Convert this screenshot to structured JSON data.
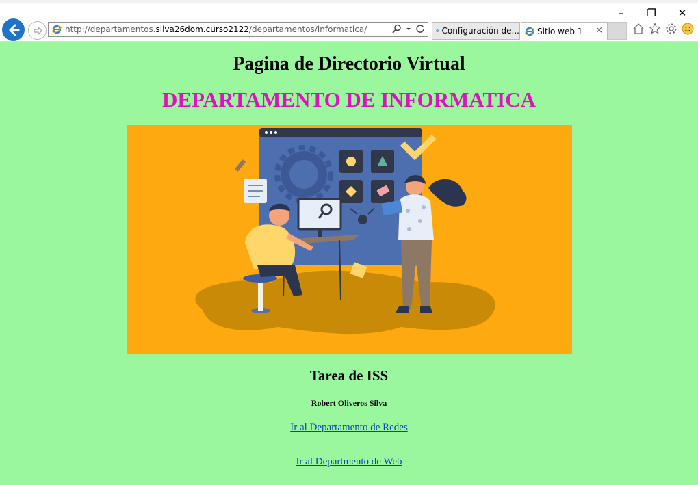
{
  "browser": {
    "address": {
      "prefix": "http://departamentos.",
      "domain": "silva26dom.curso2122",
      "path": "/departamentos/informatica/"
    },
    "tabs": [
      {
        "label": "Configuración de..."
      },
      {
        "label": "Sitio web 1",
        "close": "×"
      }
    ],
    "window_buttons": {
      "minimize": "–",
      "restore": "❐",
      "close": "✕"
    }
  },
  "page": {
    "heading": "Pagina de Directorio Virtual",
    "department": "DEPARTAMENTO DE INFORMATICA",
    "subheading": "Tarea de ISS",
    "author": "Robert Oliveros Silva",
    "links": [
      {
        "text": "Ir al Departamento de Redes"
      },
      {
        "text": "Ir al Departmento de Web"
      }
    ]
  },
  "colors": {
    "page_bg": "#9af79d",
    "department_title": "#e012c0",
    "illustration_bg": "#ffa911",
    "link": "#0b46b8"
  }
}
